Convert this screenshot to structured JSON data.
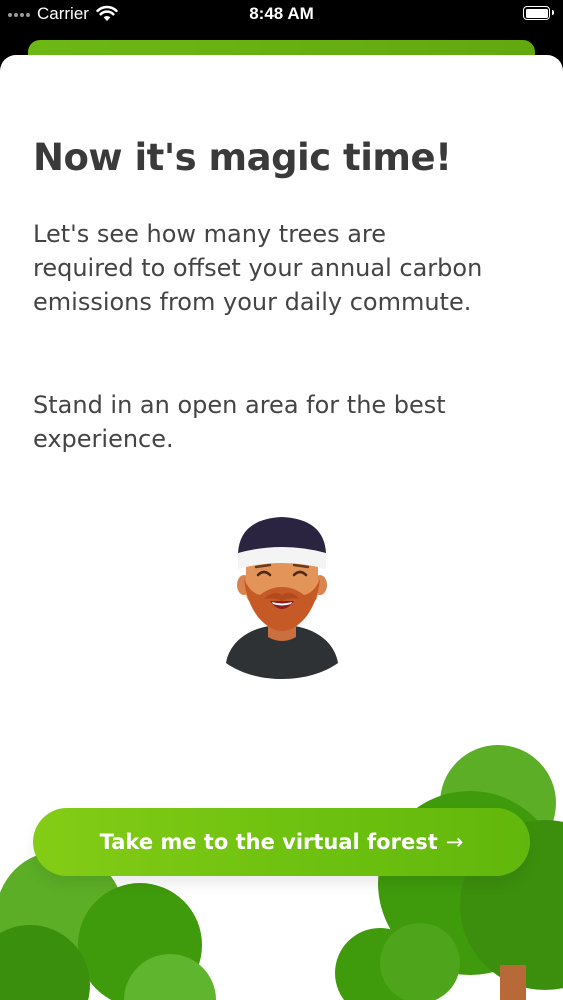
{
  "status_bar": {
    "carrier": "Carrier",
    "time": "8:48 AM",
    "wifi_icon": "wifi-icon",
    "battery_icon": "battery-icon",
    "signal_icon": "signal-dots-icon"
  },
  "main": {
    "title": "Now it's magic time!",
    "paragraph_1": "Let's see how many trees are required to offset your annual carbon emissions from your daily commute.",
    "paragraph_2": "Stand in an open area for the best experience.",
    "avatar_icon": "smiling-bearded-man-avatar"
  },
  "cta": {
    "label": "Take me to the virtual forest",
    "arrow": "→",
    "icon": "arrow-right-icon"
  },
  "colors": {
    "accent": "#7cc813",
    "title": "#3a3a3a",
    "body_text": "#444444",
    "tree_dark": "#3f9a0c",
    "tree_light": "#5cae26",
    "trunk": "#b76a37"
  }
}
